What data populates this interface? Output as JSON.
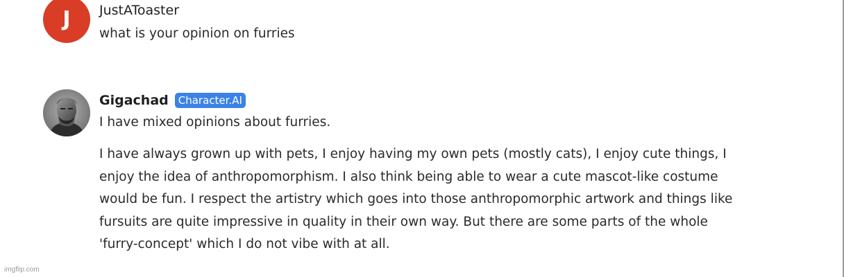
{
  "messages": {
    "user": {
      "avatar_letter": "J",
      "name": "JustAToaster",
      "text": "what is your opinion on furries"
    },
    "bot": {
      "name": "Gigachad",
      "badge": "Character.AI",
      "line1": "I have mixed opinions about furries.",
      "paragraph": "I have always grown up with pets, I enjoy having my own pets (mostly cats), I enjoy cute things, I enjoy the idea of anthropomorphism. I also think being able to wear a cute mascot-like costume would be fun. I respect the artistry which goes into those anthropomorphic artwork and things like fursuits are quite impressive in quality in their own way. But there are some parts of the whole 'furry-concept' which I do not vibe with at all."
    }
  },
  "watermark": "imgflip.com",
  "colors": {
    "user_avatar": "#d93d26",
    "badge": "#3b82e6"
  }
}
